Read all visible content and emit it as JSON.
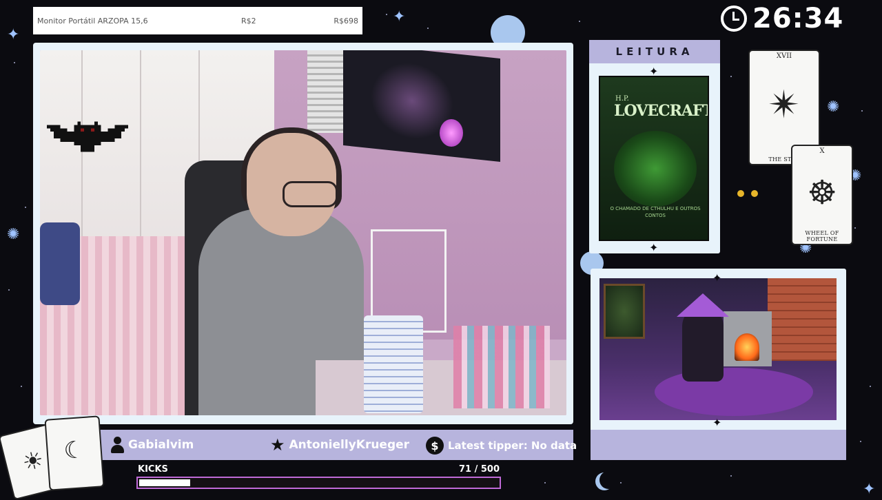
{
  "ticker": {
    "product_name": "Monitor Portátil ARZOPA 15,6",
    "price_1": "R$2",
    "price_2": "R$698"
  },
  "timer": {
    "value": "26:34"
  },
  "reading": {
    "header": "LEITURA",
    "book_author": "H.P.",
    "book_title": "LOVECRAFT",
    "book_subtitle": "O CHAMADO DE CTHULHU E OUTROS CONTOS"
  },
  "tarot": {
    "card1": {
      "number": "XVII",
      "name": "THE STAR"
    },
    "card2": {
      "number": "X",
      "name": "WHEEL OF FORTUNE"
    }
  },
  "info_bar": {
    "follower": "Gabialvim",
    "subscriber": "AntoniellyKrueger",
    "tipper": "Latest tipper: No data"
  },
  "kicks": {
    "label": "KICKS",
    "current": 71,
    "goal": 500,
    "count_text": "71 / 500"
  },
  "colors": {
    "panel_purple": "#b7b4dd",
    "panel_light": "#e8f3fb",
    "progress_border": "#c06ad8"
  }
}
